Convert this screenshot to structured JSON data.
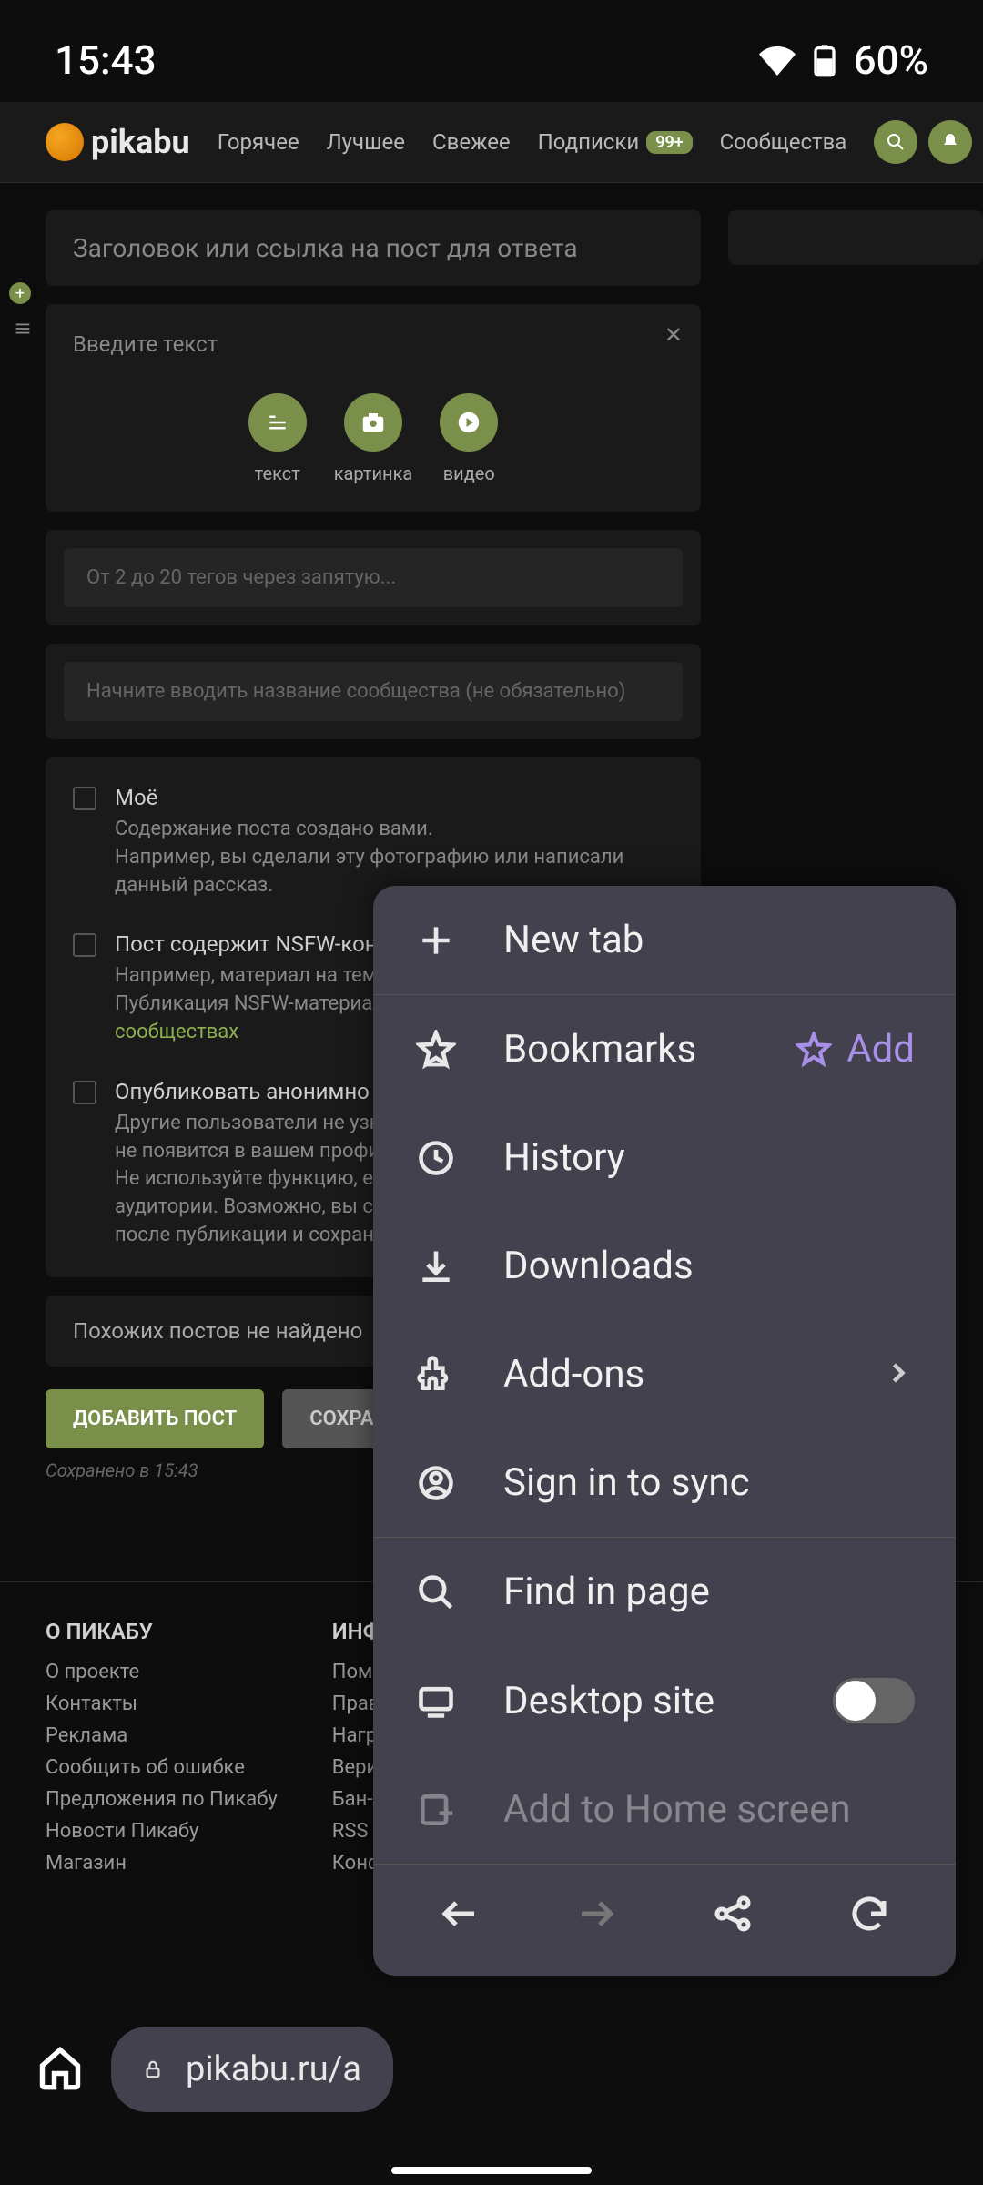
{
  "status": {
    "time": "15:43",
    "battery": "60%"
  },
  "header": {
    "brand": "pikabu",
    "nav": {
      "hot": "Горячее",
      "best": "Лучшее",
      "fresh": "Свежее",
      "subs": "Подписки",
      "subs_badge": "99+",
      "communities": "Сообщества"
    }
  },
  "editor": {
    "title_placeholder": "Заголовок или ссылка на пост для ответа",
    "body_placeholder": "Введите текст",
    "media": {
      "text": "текст",
      "image": "картинка",
      "video": "видео"
    },
    "tags_placeholder": "От 2 до 20 тегов через запятую...",
    "community_placeholder": "Начните вводить название сообщества (не обязательно)",
    "checks": {
      "mine": {
        "title": "Моё",
        "desc": "Содержание поста создано вами.\nНапример, вы сделали эту фотографию или написали данный рассказ."
      },
      "nsfw": {
        "title": "Пост содержит NSFW-контент",
        "desc1": "Например, материал на тему секса.",
        "desc2": "Публикация NSFW-материалов разрешена только в ",
        "link": "NSFW-сообществах"
      },
      "anon": {
        "title": "Опубликовать анонимно",
        "desc": "Другие пользователи не узнают, кто опубликовал пост. Он не появится в вашем профиле и не повлияет на рейтинг. Не используйте функцию, если не уверены в реакции аудитории. Возможно, вы сможете отредактировать пост после публикации и сохранить его еще раз."
      }
    },
    "similar": "Похожих постов не найдено",
    "add_btn": "ДОБАВИТЬ ПОСТ",
    "save_btn": "СОХРАНИТЬ",
    "saved_at": "Сохранено в 15:43"
  },
  "footer": {
    "col1": {
      "title": "О ПИКАБУ",
      "links": [
        "О проекте",
        "Контакты",
        "Реклама",
        "Сообщить об ошибке",
        "Предложения по Пикабу",
        "Новости Пикабу",
        "Магазин"
      ]
    },
    "col2": {
      "title": "ИНФОРМАЦИЯ",
      "links": [
        "Помощь",
        "Правила",
        "Награды",
        "Верификации",
        "Бан-лист",
        "RSS",
        "Конфиденциальн"
      ]
    }
  },
  "menu": {
    "new_tab": "New tab",
    "bookmarks": "Bookmarks",
    "add": "Add",
    "history": "History",
    "downloads": "Downloads",
    "addons": "Add-ons",
    "sign_in": "Sign in to sync",
    "find": "Find in page",
    "desktop": "Desktop site",
    "add_home": "Add to Home screen"
  },
  "browser": {
    "url": "pikabu.ru/a"
  }
}
